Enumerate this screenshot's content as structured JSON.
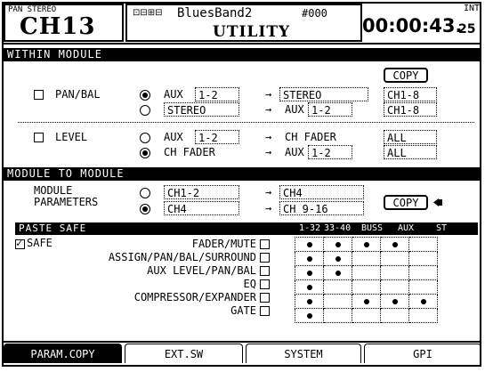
{
  "header": {
    "mode": "PAN STEREO",
    "channel": "CH13",
    "status_icons": "⊡⊟⊞⊟",
    "project_name": "BluesBand2",
    "scene_number": "#000",
    "screen_title": "UTILITY",
    "timecode_main": "00:00:43.",
    "timecode_frames": "25",
    "clock_source": "INT"
  },
  "within_module": {
    "title": "WITHIN MODULE",
    "copy_label": "COPY",
    "rows": [
      {
        "label": "PAN/BAL",
        "checked": false,
        "options": [
          {
            "selected": true,
            "src_label": "AUX",
            "src_value": "1-2",
            "dst_label": "STEREO",
            "dst_value": "",
            "target": "CH1-8"
          },
          {
            "selected": false,
            "src_label": "STEREO",
            "src_value": "",
            "dst_label": "AUX",
            "dst_value": "1-2",
            "target": "CH1-8"
          }
        ]
      },
      {
        "label": "LEVEL",
        "checked": false,
        "options": [
          {
            "selected": false,
            "src_label": "AUX",
            "src_value": "1-2",
            "dst_label": "CH FADER",
            "dst_value": "",
            "target": "ALL"
          },
          {
            "selected": true,
            "src_label": "CH FADER",
            "src_value": "",
            "dst_label": "AUX",
            "dst_value": "1-2",
            "target": "ALL"
          }
        ]
      }
    ]
  },
  "module_to_module": {
    "title": "MODULE TO MODULE",
    "label_line1": "MODULE",
    "label_line2": "PARAMETERS",
    "copy_label": "COPY",
    "options": [
      {
        "selected": false,
        "source": "CH1-2",
        "dest": "CH4"
      },
      {
        "selected": true,
        "source": "CH4",
        "dest": "CH 9-16"
      }
    ]
  },
  "paste_safe": {
    "title": "PASTE SAFE",
    "safe_label": "SAFE",
    "safe_checked": true,
    "columns": [
      "1-32",
      "33-40",
      "BUSS",
      "AUX",
      "ST"
    ],
    "rows": [
      {
        "label": "FADER/MUTE",
        "checked": false,
        "cells": [
          true,
          true,
          true,
          true,
          false
        ]
      },
      {
        "label": "ASSIGN/PAN/BAL/SURROUND",
        "checked": false,
        "cells": [
          true,
          true,
          false,
          false,
          false
        ]
      },
      {
        "label": "AUX LEVEL/PAN/BAL",
        "checked": false,
        "cells": [
          true,
          true,
          false,
          false,
          false
        ]
      },
      {
        "label": "EQ",
        "checked": false,
        "cells": [
          true,
          false,
          false,
          false,
          false
        ]
      },
      {
        "label": "COMPRESSOR/EXPANDER",
        "checked": false,
        "cells": [
          true,
          false,
          true,
          true,
          true
        ]
      },
      {
        "label": "GATE",
        "checked": false,
        "cells": [
          true,
          false,
          false,
          false,
          false
        ]
      }
    ]
  },
  "tabs": [
    {
      "label": "PARAM.COPY",
      "active": true
    },
    {
      "label": "EXT.SW",
      "active": false
    },
    {
      "label": "SYSTEM",
      "active": false
    },
    {
      "label": "GPI",
      "active": false
    }
  ],
  "arrow_glyph": "→"
}
